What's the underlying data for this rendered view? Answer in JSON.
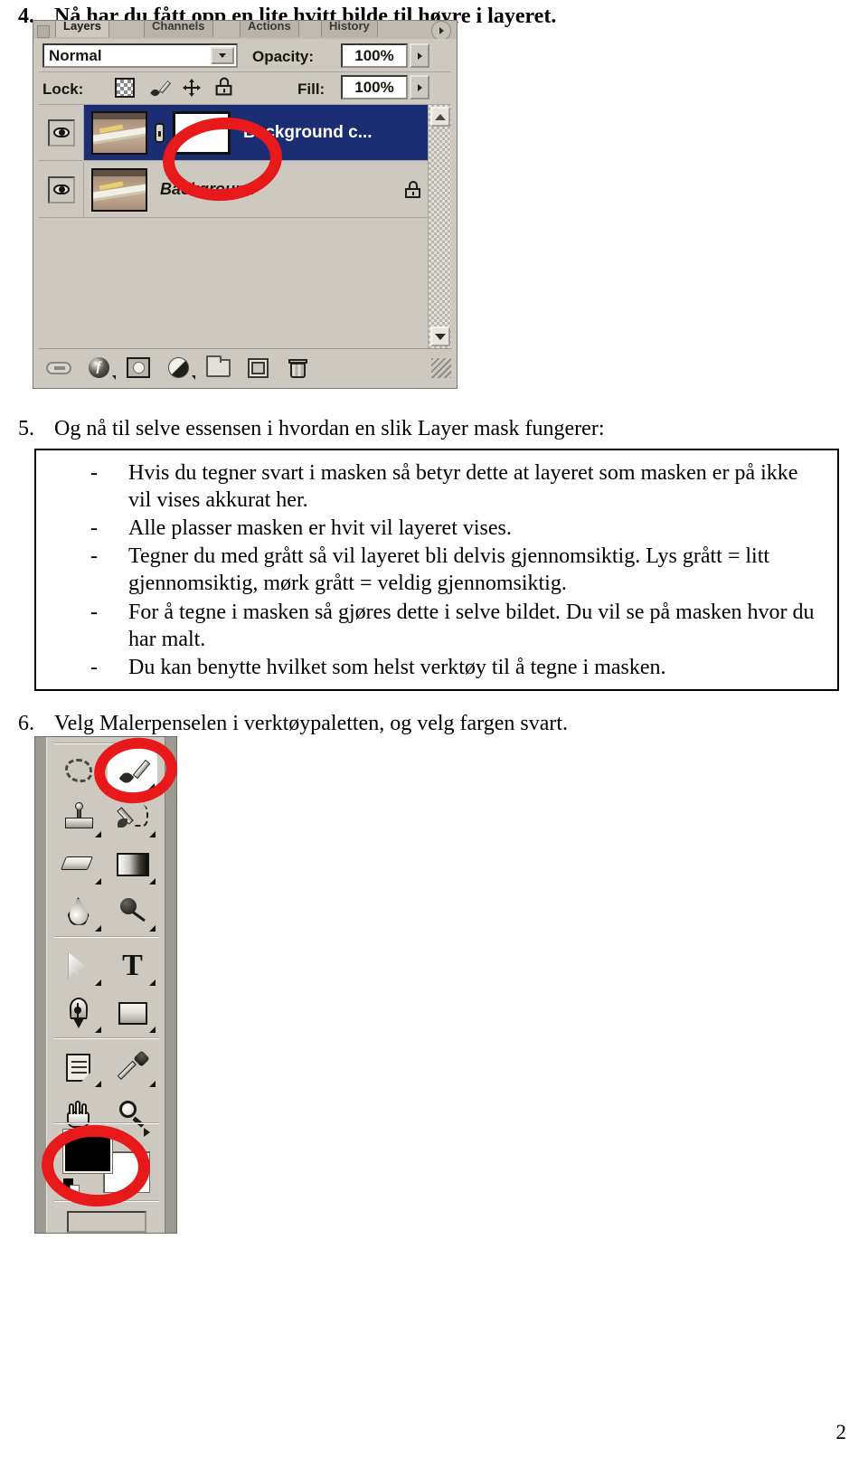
{
  "document": {
    "page_number": "2",
    "steps": [
      {
        "number": "4.",
        "text": "Nå har du fått opp en lite hvitt bilde til høyre i layeret."
      },
      {
        "number": "5.",
        "text": "Og nå til selve essensen i hvordan en slik Layer mask fungerer:"
      },
      {
        "number": "6.",
        "text": "Velg Malerpenselen i verktøypaletten, og velg fargen svart."
      }
    ],
    "info_box": {
      "bullet_marker": "-",
      "bullets": [
        "Hvis du tegner svart i masken så betyr dette at layeret som masken er på ikke vil vises akkurat her.",
        "Alle plasser masken er hvit vil layeret vises.",
        "Tegner du med grått så vil layeret bli delvis gjennomsiktig. Lys grått = litt gjennomsiktig, mørk grått = veldig gjennomsiktig.",
        "For å tegne i masken så gjøres dette i selve bildet. Du vil se på masken hvor du har malt.",
        "Du kan benytte hvilket som helst verktøy til å tegne i masken."
      ]
    }
  },
  "layers_panel": {
    "tabs": [
      {
        "label": "Layers",
        "active": true
      },
      {
        "label": "Channels",
        "active": false
      },
      {
        "label": "Actions",
        "active": false
      },
      {
        "label": "History",
        "active": false
      }
    ],
    "tab_menu_icon": "panel-menu-arrow-icon",
    "blend_mode": {
      "value": "Normal",
      "dropdown_icon": "chevron-down-icon"
    },
    "opacity": {
      "label": "Opacity:",
      "value": "100%",
      "spinner_icon": "spinner-arrow-icon"
    },
    "fill": {
      "label": "Fill:",
      "value": "100%",
      "spinner_icon": "spinner-arrow-icon"
    },
    "lock": {
      "label": "Lock:",
      "icons": [
        "lock-transparent-pixels-icon",
        "lock-image-pixels-icon",
        "lock-position-icon",
        "lock-all-icon"
      ]
    },
    "layers": [
      {
        "name": "Background c...",
        "selected": true,
        "visible": true,
        "visibility_icon": "eye-icon",
        "has_mask": true,
        "mask_color": "#ffffff",
        "link_icon": "link-chain-icon",
        "locked": false
      },
      {
        "name": "Background",
        "selected": false,
        "visible": true,
        "visibility_icon": "eye-icon",
        "has_mask": false,
        "locked": true,
        "lock_icon": "padlock-icon"
      }
    ],
    "scrollbar": {
      "up_icon": "scroll-up-arrow-icon",
      "down_icon": "scroll-down-arrow-icon"
    },
    "footer_buttons": [
      "link-layers-icon",
      "layer-style-fx-icon",
      "add-layer-mask-icon",
      "new-adjustment-layer-icon",
      "new-group-folder-icon",
      "new-layer-icon",
      "delete-layer-trash-icon"
    ]
  },
  "tool_palette": {
    "tools": [
      {
        "name": "lasso-tool",
        "icon": "lasso-icon",
        "active": false,
        "has_flyout": false
      },
      {
        "name": "brush-tool",
        "icon": "paintbrush-icon",
        "active": true,
        "has_flyout": true
      },
      {
        "name": "clone-stamp-tool",
        "icon": "clone-stamp-icon",
        "active": false,
        "has_flyout": true
      },
      {
        "name": "history-brush-tool",
        "icon": "history-brush-icon",
        "active": false,
        "has_flyout": true
      },
      {
        "name": "eraser-tool",
        "icon": "eraser-icon",
        "active": false,
        "has_flyout": true
      },
      {
        "name": "gradient-tool",
        "icon": "gradient-icon",
        "active": false,
        "has_flyout": true
      },
      {
        "name": "blur-tool",
        "icon": "blur-droplet-icon",
        "active": false,
        "has_flyout": true
      },
      {
        "name": "dodge-tool",
        "icon": "dodge-icon",
        "active": false,
        "has_flyout": true
      },
      {
        "name": "path-selection-tool",
        "icon": "path-arrow-icon",
        "active": false,
        "has_flyout": true
      },
      {
        "name": "type-tool",
        "icon": "type-t-icon",
        "active": false,
        "has_flyout": true
      },
      {
        "name": "pen-tool",
        "icon": "pen-nib-icon",
        "active": false,
        "has_flyout": true
      },
      {
        "name": "shape-tool",
        "icon": "rectangle-shape-icon",
        "active": false,
        "has_flyout": true
      },
      {
        "name": "notes-tool",
        "icon": "notes-icon",
        "active": false,
        "has_flyout": true
      },
      {
        "name": "eyedropper-tool",
        "icon": "eyedropper-icon",
        "active": false,
        "has_flyout": true
      },
      {
        "name": "hand-tool",
        "icon": "hand-icon",
        "active": false,
        "has_flyout": false
      },
      {
        "name": "zoom-tool",
        "icon": "magnifier-icon",
        "active": false,
        "has_flyout": false
      }
    ],
    "color_swatches": {
      "foreground": "#000000",
      "background": "#ffffff",
      "swap_icon": "swap-colors-icon",
      "default_icon": "default-colors-icon"
    }
  },
  "annotations": {
    "highlight_color": "#e8191b",
    "circles": [
      {
        "target": "layer-mask-thumbnail",
        "shape": "hand-drawn-ellipse"
      },
      {
        "target": "brush-tool",
        "shape": "hand-drawn-ellipse"
      },
      {
        "target": "foreground-color-swatch",
        "shape": "hand-drawn-ellipse"
      }
    ]
  }
}
